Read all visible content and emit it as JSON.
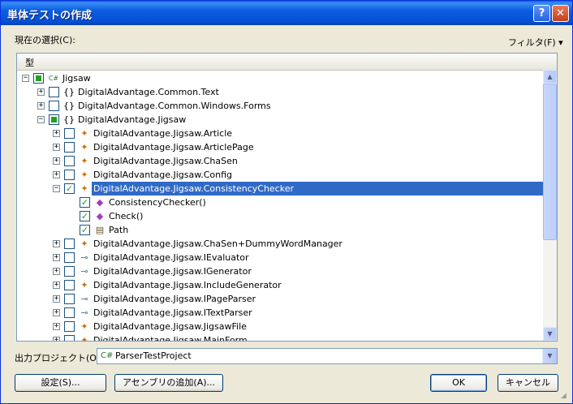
{
  "window": {
    "title": "単体テストの作成"
  },
  "selection_label": "現在の選択(C):",
  "filter_label": "フィルタ(F) ▾",
  "tree": {
    "column_header": "型",
    "rows": [
      {
        "level": 0,
        "expander": "−",
        "check": "partial",
        "icon": "C#",
        "icon_name": "csharp-project-icon",
        "label": "Jigsaw"
      },
      {
        "level": 1,
        "expander": "+",
        "check": "none",
        "icon": "{}",
        "icon_name": "namespace-icon",
        "label": "DigitalAdvantage.Common.Text"
      },
      {
        "level": 1,
        "expander": "+",
        "check": "none",
        "icon": "{}",
        "icon_name": "namespace-icon",
        "label": "DigitalAdvantage.Common.Windows.Forms"
      },
      {
        "level": 1,
        "expander": "−",
        "check": "partial",
        "icon": "{}",
        "icon_name": "namespace-icon",
        "label": "DigitalAdvantage.Jigsaw"
      },
      {
        "level": 2,
        "expander": "+",
        "check": "none",
        "icon": "✦",
        "icon_name": "class-icon",
        "label": "DigitalAdvantage.Jigsaw.Article"
      },
      {
        "level": 2,
        "expander": "+",
        "check": "none",
        "icon": "✦",
        "icon_name": "class-icon",
        "label": "DigitalAdvantage.Jigsaw.ArticlePage"
      },
      {
        "level": 2,
        "expander": "+",
        "check": "none",
        "icon": "✦",
        "icon_name": "class-icon",
        "label": "DigitalAdvantage.Jigsaw.ChaSen"
      },
      {
        "level": 2,
        "expander": "+",
        "check": "none",
        "icon": "✦",
        "icon_name": "class-icon",
        "label": "DigitalAdvantage.Jigsaw.Config"
      },
      {
        "level": 2,
        "expander": "−",
        "check": "checked",
        "icon": "✦",
        "icon_name": "class-icon",
        "label": "DigitalAdvantage.Jigsaw.ConsistencyChecker",
        "selected": true
      },
      {
        "level": 3,
        "expander": "",
        "check": "checked",
        "icon": "◆",
        "icon_name": "method-icon",
        "label": "ConsistencyChecker()"
      },
      {
        "level": 3,
        "expander": "",
        "check": "checked",
        "icon": "◆",
        "icon_name": "method-icon",
        "label": "Check()"
      },
      {
        "level": 3,
        "expander": "",
        "check": "checked",
        "icon": "▤",
        "icon_name": "property-icon",
        "label": "Path"
      },
      {
        "level": 2,
        "expander": "+",
        "check": "none",
        "icon": "✦",
        "icon_name": "class-icon",
        "label": "DigitalAdvantage.Jigsaw.ChaSen+DummyWordManager"
      },
      {
        "level": 2,
        "expander": "+",
        "check": "none",
        "icon": "⊸",
        "icon_name": "interface-icon",
        "label": "DigitalAdvantage.Jigsaw.IEvaluator"
      },
      {
        "level": 2,
        "expander": "+",
        "check": "none",
        "icon": "⊸",
        "icon_name": "interface-icon",
        "label": "DigitalAdvantage.Jigsaw.IGenerator"
      },
      {
        "level": 2,
        "expander": "+",
        "check": "none",
        "icon": "✦",
        "icon_name": "class-icon",
        "label": "DigitalAdvantage.Jigsaw.IncludeGenerator"
      },
      {
        "level": 2,
        "expander": "+",
        "check": "none",
        "icon": "⊸",
        "icon_name": "interface-icon",
        "label": "DigitalAdvantage.Jigsaw.IPageParser"
      },
      {
        "level": 2,
        "expander": "+",
        "check": "none",
        "icon": "⊸",
        "icon_name": "interface-icon",
        "label": "DigitalAdvantage.Jigsaw.ITextParser"
      },
      {
        "level": 2,
        "expander": "+",
        "check": "none",
        "icon": "✦",
        "icon_name": "class-icon",
        "label": "DigitalAdvantage.Jigsaw.JigsawFile"
      },
      {
        "level": 2,
        "expander": "+",
        "check": "none",
        "icon": "✦",
        "icon_name": "class-icon",
        "label": "DigitalAdvantage.Jigsaw.MainForm"
      }
    ]
  },
  "output_project": {
    "label": "出力プロジェクト(O):",
    "value": "ParserTestProject"
  },
  "buttons": {
    "settings": "設定(S)...",
    "add_assembly": "アセンブリの追加(A)...",
    "ok": "OK",
    "cancel": "キャンセル"
  },
  "colors": {
    "title_bar": "#0b5ee1",
    "selection": "#316ac5",
    "check": "#21a121"
  }
}
